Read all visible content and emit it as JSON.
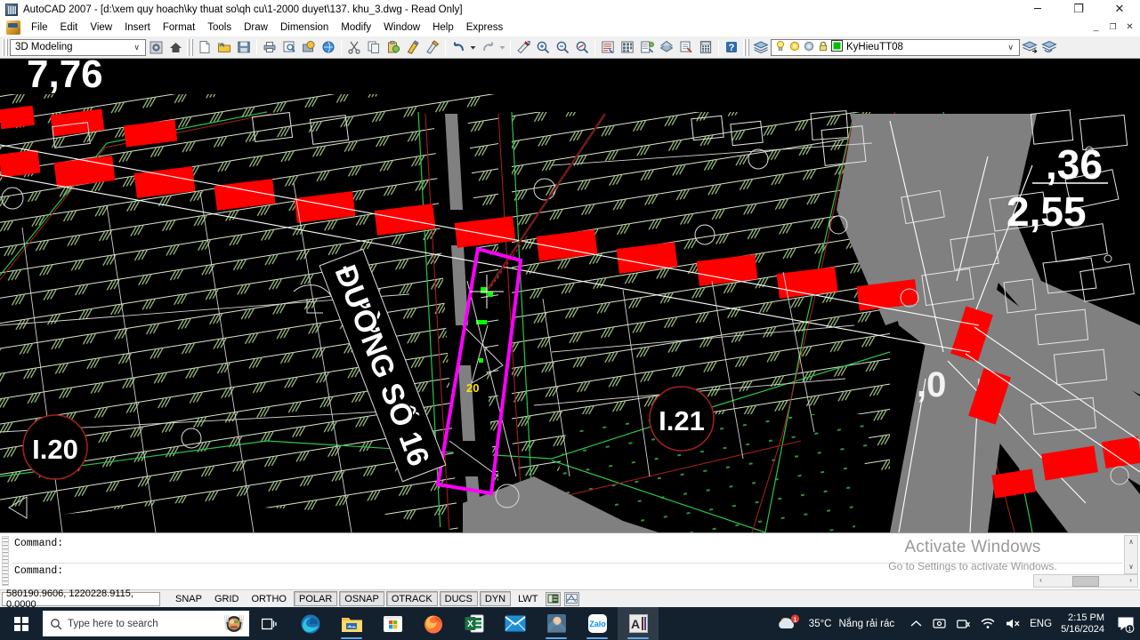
{
  "window": {
    "title": "AutoCAD 2007 - [d:\\xem quy hoach\\ky thuat so\\qh cu\\1-2000 duyet\\137. khu_3.dwg - Read Only]",
    "app_icon": "autocad-icon",
    "minimize": "─",
    "maximize": "❐",
    "close": "✕",
    "inner_minimize": "_",
    "inner_maximize": "❐",
    "inner_close": "✕"
  },
  "menu": {
    "items": [
      {
        "label": "File"
      },
      {
        "label": "Edit"
      },
      {
        "label": "View"
      },
      {
        "label": "Insert"
      },
      {
        "label": "Format"
      },
      {
        "label": "Tools"
      },
      {
        "label": "Draw"
      },
      {
        "label": "Dimension"
      },
      {
        "label": "Modify"
      },
      {
        "label": "Window"
      },
      {
        "label": "Help"
      },
      {
        "label": "Express"
      }
    ]
  },
  "toolbar": {
    "workspace": {
      "value": "3D Modeling",
      "caret": "∨"
    },
    "workspace_settings_icon": "workspace-settings-icon",
    "workspace_home_icon": "workspace-home-icon",
    "standard_buttons": [
      {
        "name": "new-file-icon",
        "glyph": "□"
      },
      {
        "name": "open-file-icon",
        "glyph": "▣"
      },
      {
        "name": "save-icon",
        "glyph": "▤"
      },
      {
        "name": "plot-icon",
        "glyph": "⎙"
      },
      {
        "name": "plot-preview-icon",
        "glyph": "⎘"
      },
      {
        "name": "publish-icon",
        "glyph": "⧉"
      },
      {
        "name": "3dprint-icon",
        "glyph": "◔"
      },
      {
        "name": "cut-icon",
        "glyph": "✂"
      },
      {
        "name": "copy-icon",
        "glyph": "⧉"
      },
      {
        "name": "paste-icon",
        "glyph": "▦"
      },
      {
        "name": "match-properties-icon",
        "glyph": "✎"
      },
      {
        "name": "block-editor-icon",
        "glyph": "◩"
      },
      {
        "name": "undo-icon",
        "glyph": "↶"
      },
      {
        "name": "undo-dropdown-icon",
        "glyph": "▾"
      },
      {
        "name": "redo-icon",
        "glyph": "↷"
      },
      {
        "name": "redo-dropdown-icon",
        "glyph": "▾"
      },
      {
        "name": "pan-realtime-icon",
        "glyph": "✋"
      },
      {
        "name": "zoom-realtime-icon",
        "glyph": "⌕"
      },
      {
        "name": "zoom-window-icon",
        "glyph": "⌕"
      },
      {
        "name": "zoom-previous-icon",
        "glyph": "⌕"
      },
      {
        "name": "zoom-scale-icon",
        "glyph": "⌕"
      },
      {
        "name": "properties-icon",
        "glyph": "☰"
      },
      {
        "name": "design-center-icon",
        "glyph": "▦"
      },
      {
        "name": "tool-palettes-icon",
        "glyph": "▥"
      },
      {
        "name": "sheet-set-manager-icon",
        "glyph": "⌗"
      },
      {
        "name": "markup-set-manager-icon",
        "glyph": "◰"
      },
      {
        "name": "quick-calc-icon",
        "glyph": "⌨"
      },
      {
        "name": "help-icon",
        "glyph": "?"
      }
    ],
    "layers_icon": "layers-stack-icon",
    "layer": {
      "on_off_icon": "lightbulb-icon",
      "freeze_icon": "sun-icon",
      "lock_icon": "lock-icon",
      "plot_icon": "plot-icon",
      "color_swatch": "#00c000",
      "value": "KyHieuTT08",
      "caret": "∨"
    },
    "layer_previous_icon": "layer-previous-icon",
    "layer_properties_icon": "layer-properties-manager-icon"
  },
  "drawing": {
    "labels": [
      {
        "id": "top-left-dimension",
        "text": "7,76"
      },
      {
        "id": "parcel-i20",
        "text": "I.20"
      },
      {
        "id": "parcel-i21",
        "text": "I.21"
      },
      {
        "id": "street-name",
        "text": "ĐƯỜNG SỐ 16"
      },
      {
        "id": "dimension-36",
        "text": ",36"
      },
      {
        "id": "dimension-255",
        "text": "2,55"
      },
      {
        "id": "selection-dim",
        "text": "20"
      }
    ],
    "colors": {
      "background": "#000000",
      "road_fill": "#808080",
      "red_blocks": "#ff0000",
      "parcel_line_red": "#9b1d1d",
      "hatch_green": "#b9d3a0",
      "hatch_white": "#e8e8e8",
      "selection_magenta": "#ff00ff",
      "grip_green": "#00ff00",
      "text_white": "#ffffff"
    }
  },
  "command_window": {
    "lines": [
      "Command:",
      "Command:"
    ],
    "scroll_up": "∧",
    "scroll_down": "∨",
    "scroll_left": "‹",
    "scroll_right": "›"
  },
  "watermark": {
    "line1": "Activate Windows",
    "line2": "Go to Settings to activate Windows."
  },
  "status_bar": {
    "coordinates": "580190.9606, 1220228.9115, 0.0000",
    "toggles": [
      {
        "label": "SNAP",
        "on": false
      },
      {
        "label": "GRID",
        "on": false
      },
      {
        "label": "ORTHO",
        "on": false
      },
      {
        "label": "POLAR",
        "on": true
      },
      {
        "label": "OSNAP",
        "on": true
      },
      {
        "label": "OTRACK",
        "on": true
      },
      {
        "label": "DUCS",
        "on": true
      },
      {
        "label": "DYN",
        "on": true
      },
      {
        "label": "LWT",
        "on": false
      }
    ],
    "model_space_icon": "model-space-icon",
    "annotation_scale_icon": "annotation-scale-icon"
  },
  "taskbar": {
    "start_icon": "windows-start-icon",
    "search": {
      "placeholder": "Type here to search",
      "icon": "search-icon"
    },
    "cortana_icon": "food-widget-icon",
    "task_view_icon": "task-view-icon",
    "apps": [
      {
        "name": "edge-icon",
        "label": "Microsoft Edge",
        "running": false,
        "active": false
      },
      {
        "name": "file-explorer-icon",
        "label": "File Explorer",
        "running": true,
        "active": false
      },
      {
        "name": "microsoft-store-icon",
        "label": "Microsoft Store",
        "running": false,
        "active": false
      },
      {
        "name": "firefox-icon",
        "label": "Firefox",
        "running": false,
        "active": false
      },
      {
        "name": "excel-icon",
        "label": "Excel",
        "running": false,
        "active": false
      },
      {
        "name": "mail-icon",
        "label": "Mail",
        "running": false,
        "active": false
      },
      {
        "name": "photos-icon",
        "label": "Photos",
        "running": true,
        "active": false
      },
      {
        "name": "zalo-icon",
        "label": "Zalo",
        "running": true,
        "active": false
      },
      {
        "name": "autocad-icon",
        "label": "AutoCAD 2007",
        "running": true,
        "active": true
      }
    ],
    "tray": {
      "weather_temp": "35°C",
      "weather_desc": "Nắng rải rác",
      "weather_icon": "sun-cloud-icon",
      "weather_badge": "1",
      "chevron_icon": "show-hidden-icons-icon",
      "onedrive_icon": "onedrive-icon",
      "removable_icon": "safely-remove-hardware-icon",
      "network_icon": "wifi-icon",
      "volume_icon": "volume-muted-icon",
      "language": "ENG",
      "time": "2:15 PM",
      "date": "5/16/2024",
      "action_center_icon": "action-center-icon",
      "action_center_badge": "1"
    }
  }
}
